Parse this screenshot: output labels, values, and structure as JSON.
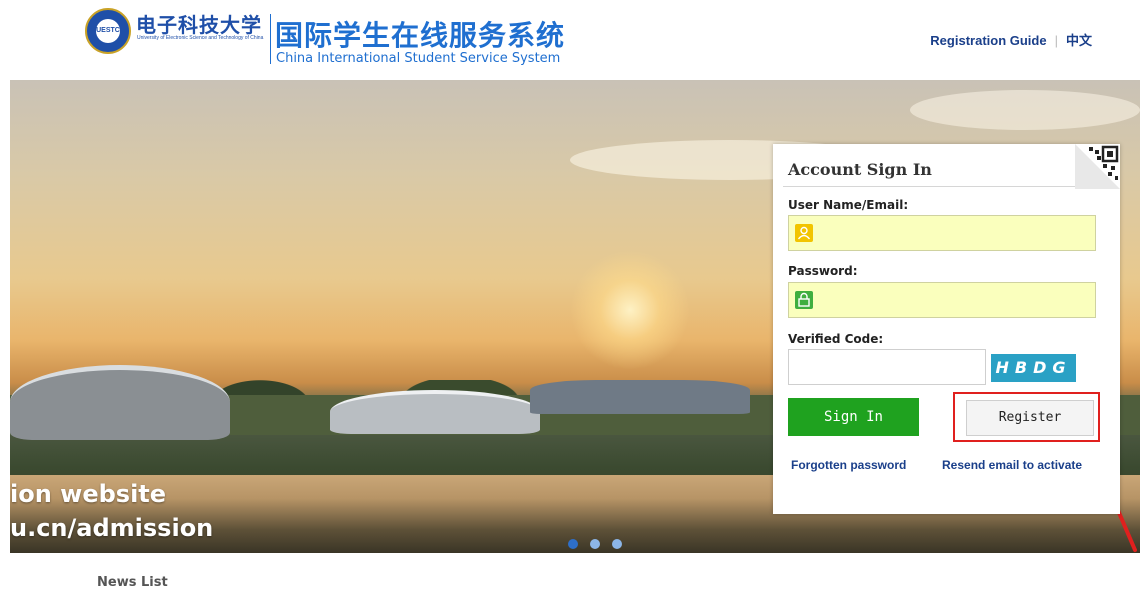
{
  "header": {
    "university_cn": "电子科技大学",
    "university_en": "University of Electronic Science and Technology of China",
    "logo_text": "UESTC",
    "system_cn": "国际学生在线服务系统",
    "system_en": "China International Student Service System",
    "registration_guide": "Registration Guide",
    "language_toggle": "中文"
  },
  "banner": {
    "caption_line1": "ion website",
    "caption_line2": "u.cn/admission",
    "slide_count": 3,
    "active_slide": 1
  },
  "login": {
    "title": "Account Sign In",
    "username_label": "User Name/Email:",
    "username_value": "",
    "password_label": "Password:",
    "password_value": "",
    "code_label": "Verified Code:",
    "code_value": "",
    "captcha_text": "HBDG",
    "signin_label": "Sign In",
    "register_label": "Register",
    "forgot_link": "Forgotten password",
    "resend_link": "Resend email to activate"
  },
  "news": {
    "title": "News List"
  },
  "colors": {
    "brand_blue": "#1f6fd0",
    "link_navy": "#1a3f8a",
    "signin_green": "#1fa21f",
    "autofill_yellow": "#faffbd",
    "highlight_red": "#e0201e",
    "captcha_teal": "#2aa1c5"
  },
  "icons": [
    "user-icon",
    "lock-icon",
    "qr-code-icon",
    "red-arrow-annotation"
  ]
}
